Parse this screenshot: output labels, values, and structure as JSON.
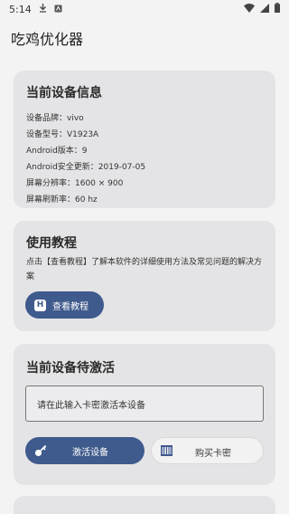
{
  "status_bar": {
    "time": "5:14"
  },
  "app": {
    "title": "吃鸡优化器"
  },
  "device_info": {
    "title": "当前设备信息",
    "rows": [
      "设备品牌：vivo",
      "设备型号：V1923A",
      "Android版本：9",
      "Android安全更新：2019-07-05",
      "屏幕分辨率：1600 × 900",
      "屏幕刷新率：60 hz"
    ]
  },
  "tutorial": {
    "title": "使用教程",
    "description": "点击【查看教程】了解本软件的详细使用方法及常见问题的解决方案",
    "button_label": "查看教程",
    "button_icon_letter": "H"
  },
  "activation": {
    "title": "当前设备待激活",
    "input_placeholder": "请在此输入卡密激活本设备",
    "activate_label": "激活设备",
    "buy_label": "购买卡密"
  },
  "colors": {
    "accent": "#3f5a8c",
    "card_bg": "#e4e4e6",
    "page_bg": "#f3f3f3"
  }
}
